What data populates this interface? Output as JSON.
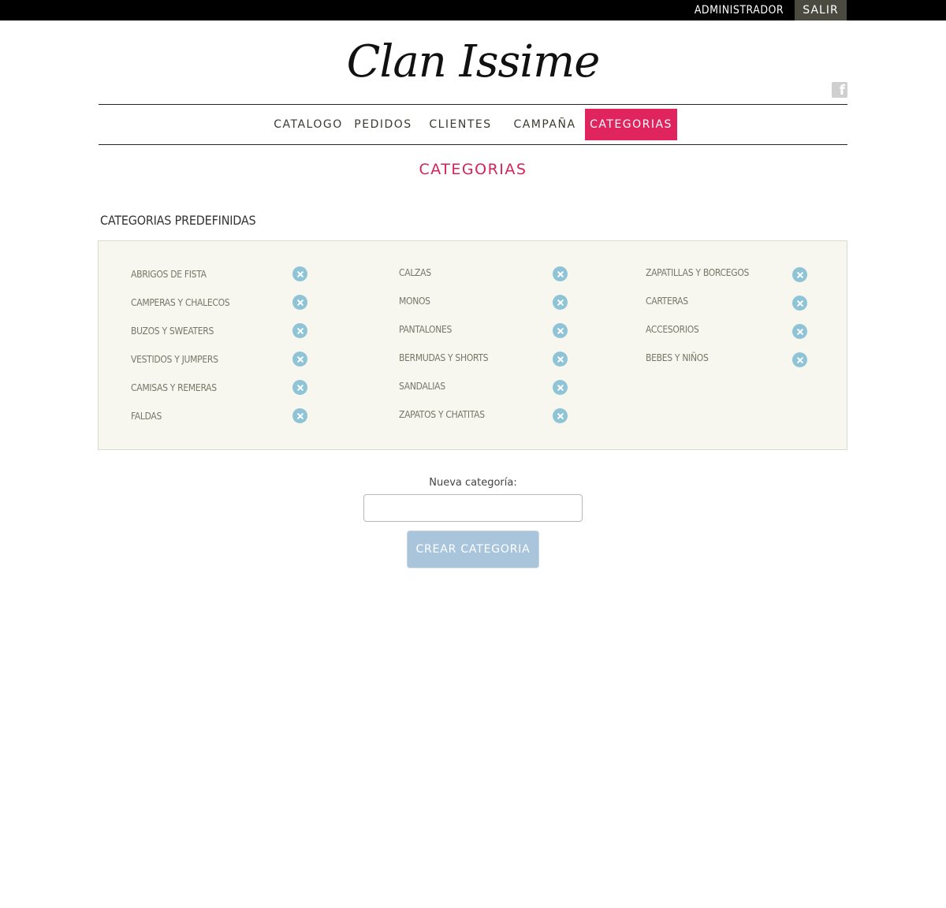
{
  "topbar": {
    "admin_label": "ADMINISTRADOR",
    "logout_label": "SALIR"
  },
  "brand": {
    "logo_text": "Clan Issime",
    "social_icon": "facebook-icon"
  },
  "nav": {
    "items": [
      {
        "label": "CATALOGO",
        "active": false
      },
      {
        "label": "PEDIDOS",
        "active": false
      },
      {
        "label": "CLIENTES",
        "active": false
      },
      {
        "label": "CAMPAÑA",
        "active": false
      },
      {
        "label": "CATEGORIAS",
        "active": true
      }
    ]
  },
  "page": {
    "title": "CATEGORIAS",
    "section_title": "CATEGORIAS PREDEFINIDAS"
  },
  "categories": {
    "columns": [
      [
        "ABRIGOS DE FISTA",
        "CAMPERAS Y CHALECOS",
        "BUZOS Y SWEATERS",
        "VESTIDOS Y JUMPERS",
        "CAMISAS Y REMERAS",
        "FALDAS"
      ],
      [
        "CALZAS",
        "MONOS",
        "PANTALONES",
        "BERMUDAS Y SHORTS",
        "SANDALIAS",
        "ZAPATOS Y CHATITAS"
      ],
      [
        "ZAPATILLAS Y BORCEGOS",
        "CARTERAS",
        "ACCESORIOS",
        "BEBES Y NIÑOS"
      ]
    ],
    "delete_icon": "close-circle-icon"
  },
  "form": {
    "label": "Nueva categoría:",
    "input_value": "",
    "button_label": "CREAR CATEGORIA"
  },
  "colors": {
    "accent": "#e0245e",
    "panel_bg": "#f7f6ef",
    "delete_icon": "#8fc4d6",
    "button": "#a9c5dc"
  }
}
